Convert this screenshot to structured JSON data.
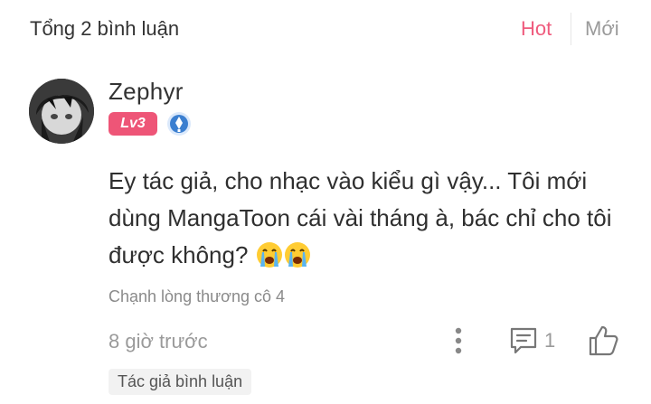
{
  "header": {
    "total_label": "Tổng 2 bình luận",
    "tabs": [
      {
        "label": "Hot",
        "active": true
      },
      {
        "label": "Mới",
        "active": false
      }
    ]
  },
  "comment": {
    "username": "Zephyr",
    "level": "Lv3",
    "text": "Ey tác giả, cho nhạc vào kiểu gì vậy... Tôi mới dùng MangaToon cái vài tháng à, bác chỉ cho tôi được không?",
    "emojis": [
      "loudly-crying-face",
      "loudly-crying-face"
    ],
    "reply_preview": "Chạnh lòng thương cô 4",
    "time": "8 giờ trước",
    "reply_count": "1",
    "tag": "Tác giả bình luận"
  },
  "colors": {
    "accent": "#ef5b7d",
    "level_badge": "#ee5577",
    "medal_blue": "#3b7fd0",
    "muted_text": "#9a9a9a"
  }
}
